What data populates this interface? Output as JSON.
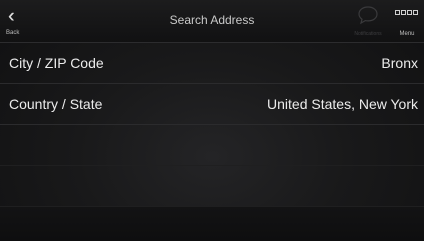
{
  "header": {
    "title": "Search Address",
    "back_label": "Back",
    "notifications_label": "Notifications",
    "menu_label": "Menu"
  },
  "fields": [
    {
      "label": "City / ZIP Code",
      "value": "Bronx"
    },
    {
      "label": "Country / State",
      "value": "United States, New York"
    }
  ],
  "icons": {
    "back": "double-chevron-left-icon",
    "notifications": "speech-bubble-icon",
    "menu": "four-squares-icon"
  },
  "colors": {
    "text": "#ececec",
    "disabled": "#3e3e40",
    "background": "#19191a"
  }
}
